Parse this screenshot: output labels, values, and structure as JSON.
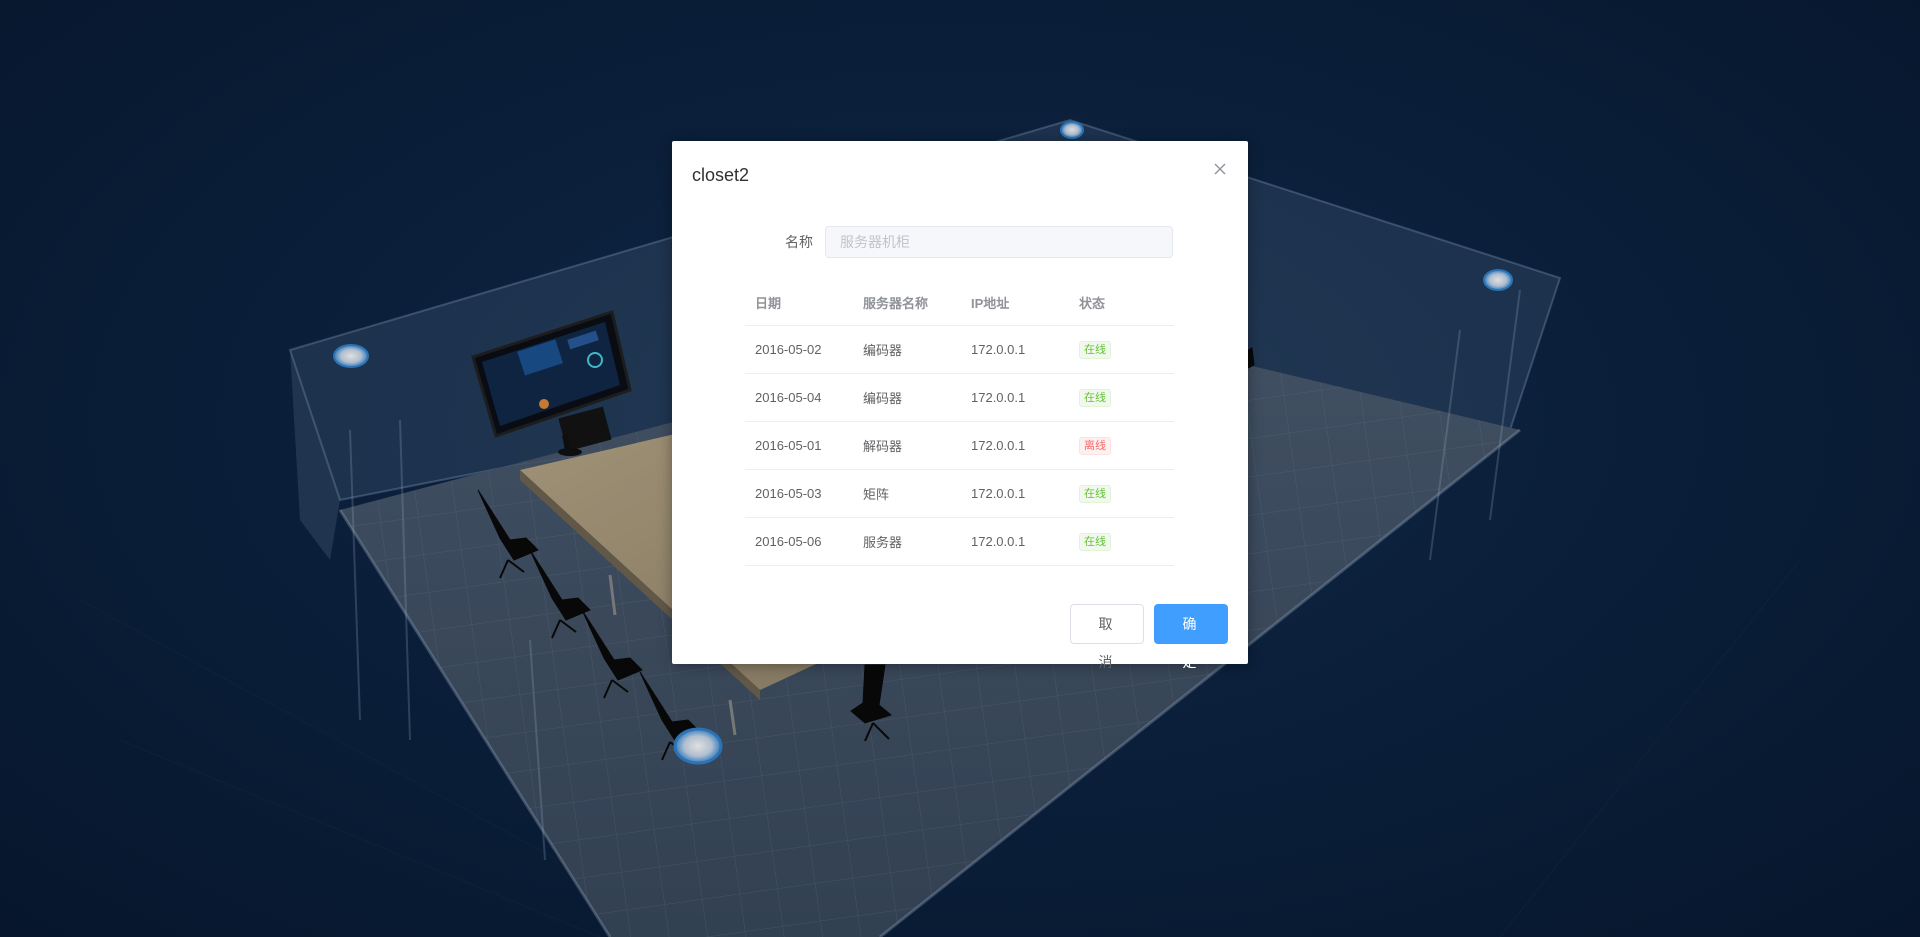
{
  "dialog": {
    "title": "closet2",
    "close_icon": "close-icon"
  },
  "form": {
    "name_label": "名称",
    "name_placeholder": "服务器机柜",
    "name_value": ""
  },
  "table": {
    "headers": [
      "日期",
      "服务器名称",
      "IP地址",
      "状态"
    ],
    "rows": [
      {
        "date": "2016-05-02",
        "name": "编码器",
        "ip": "172.0.0.1",
        "status": "在线",
        "state": "online"
      },
      {
        "date": "2016-05-04",
        "name": "编码器",
        "ip": "172.0.0.1",
        "status": "在线",
        "state": "online"
      },
      {
        "date": "2016-05-01",
        "name": "解码器",
        "ip": "172.0.0.1",
        "status": "离线",
        "state": "offline"
      },
      {
        "date": "2016-05-03",
        "name": "矩阵",
        "ip": "172.0.0.1",
        "status": "在线",
        "state": "online"
      },
      {
        "date": "2016-05-06",
        "name": "服务器",
        "ip": "172.0.0.1",
        "status": "在线",
        "state": "online"
      }
    ]
  },
  "footer": {
    "cancel_label": "取 消",
    "confirm_label": "确 定"
  },
  "colors": {
    "primary": "#409eff",
    "online": "#67c23a",
    "offline": "#f56c6c",
    "background": "#0d2443"
  }
}
